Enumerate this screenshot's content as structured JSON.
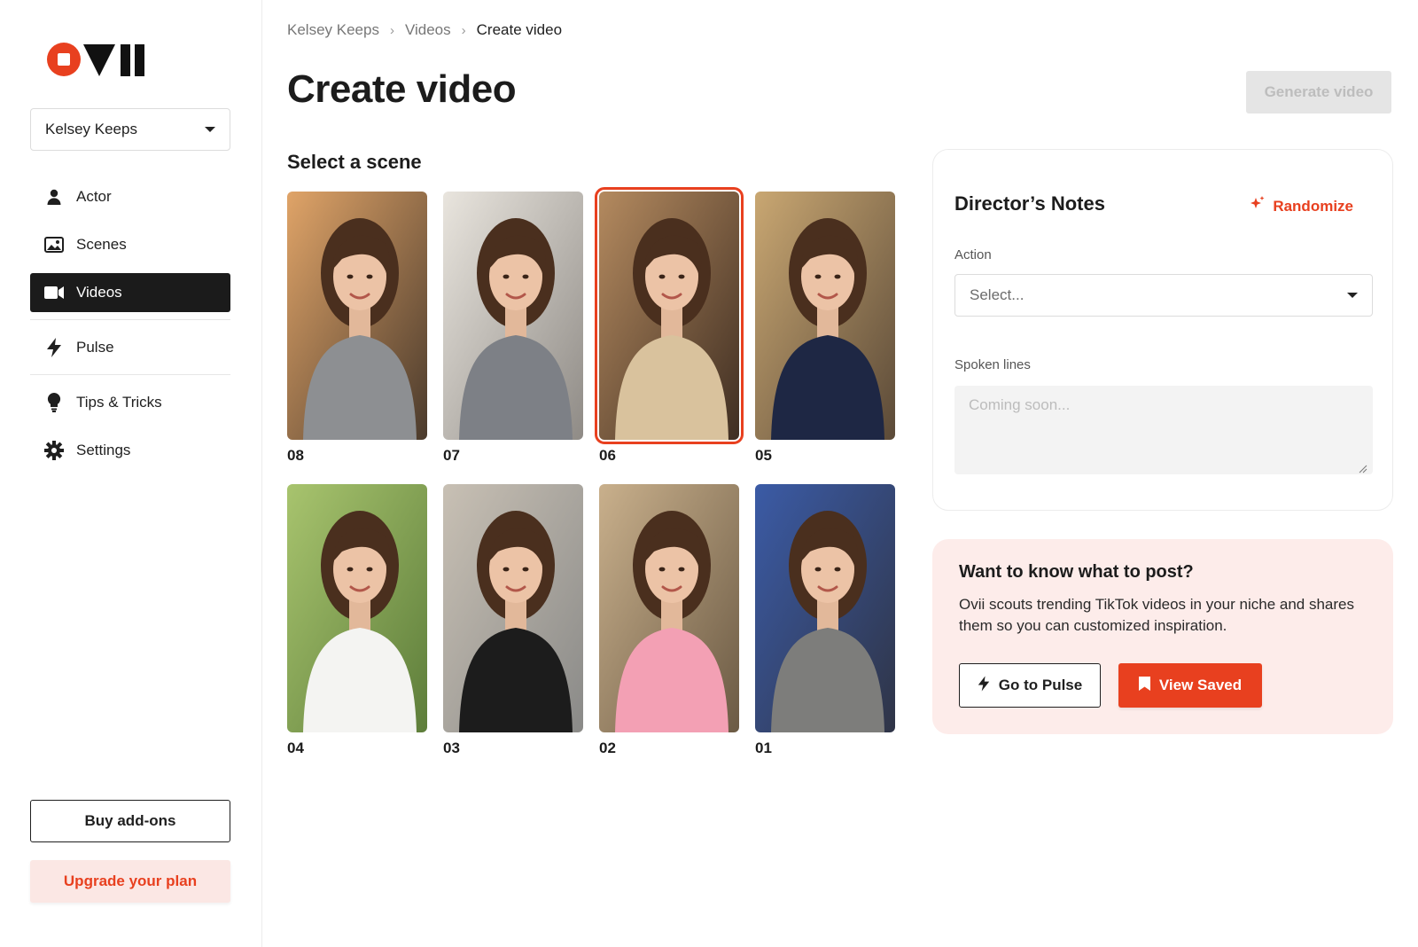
{
  "app": {
    "logo_name": "ovii-logo"
  },
  "sidebar": {
    "brand_selector": {
      "value": "Kelsey Keeps"
    },
    "items": [
      {
        "label": "Actor",
        "icon": "person-icon"
      },
      {
        "label": "Scenes",
        "icon": "image-icon"
      },
      {
        "label": "Videos",
        "icon": "video-camera-icon",
        "active": true
      },
      {
        "label": "Pulse",
        "icon": "lightning-icon"
      },
      {
        "label": "Tips & Tricks",
        "icon": "lightbulb-icon"
      },
      {
        "label": "Settings",
        "icon": "gear-icon"
      }
    ],
    "buy_addons_label": "Buy add-ons",
    "upgrade_label": "Upgrade your plan"
  },
  "breadcrumb": {
    "items": [
      "Kelsey Keeps",
      "Videos",
      "Create video"
    ]
  },
  "header": {
    "title": "Create video",
    "generate_label": "Generate video"
  },
  "scenes": {
    "title": "Select a scene",
    "selected": "06",
    "items": [
      {
        "num": "08",
        "outfit": "#8d8f92",
        "bg": "#4a3a2c",
        "light": "#e0a468"
      },
      {
        "num": "07",
        "outfit": "#7d8086",
        "bg": "#8f8b86",
        "light": "#e9e5de"
      },
      {
        "num": "06",
        "outfit": "#d9c29d",
        "bg": "#3f2e22",
        "light": "#b48a5f"
      },
      {
        "num": "05",
        "outfit": "#1e2744",
        "bg": "#5b4a38",
        "light": "#c9a772"
      },
      {
        "num": "04",
        "outfit": "#f4f4f2",
        "bg": "#5d7d3a",
        "light": "#a8c46e"
      },
      {
        "num": "03",
        "outfit": "#1c1c1c",
        "bg": "#8a8a88",
        "light": "#c8c0b4"
      },
      {
        "num": "02",
        "outfit": "#f3a0b4",
        "bg": "#6b5a44",
        "light": "#c9b08c"
      },
      {
        "num": "01",
        "outfit": "#7d7d7b",
        "bg": "#2f3446",
        "light": "#3b5ba6"
      }
    ]
  },
  "notes": {
    "title": "Director’s Notes",
    "randomize_label": "Randomize",
    "action_label": "Action",
    "action_placeholder": "Select...",
    "spoken_label": "Spoken lines",
    "spoken_placeholder": "Coming soon..."
  },
  "pulse": {
    "title": "Want to know what to post?",
    "text": "Ovii scouts trending TikTok videos in your niche and shares them so you can customized inspiration.",
    "go_label": "Go to Pulse",
    "saved_label": "View Saved"
  },
  "colors": {
    "accent": "#e8401f",
    "active_nav": "#1b1b1b",
    "pulse_bg": "#fdecea"
  }
}
